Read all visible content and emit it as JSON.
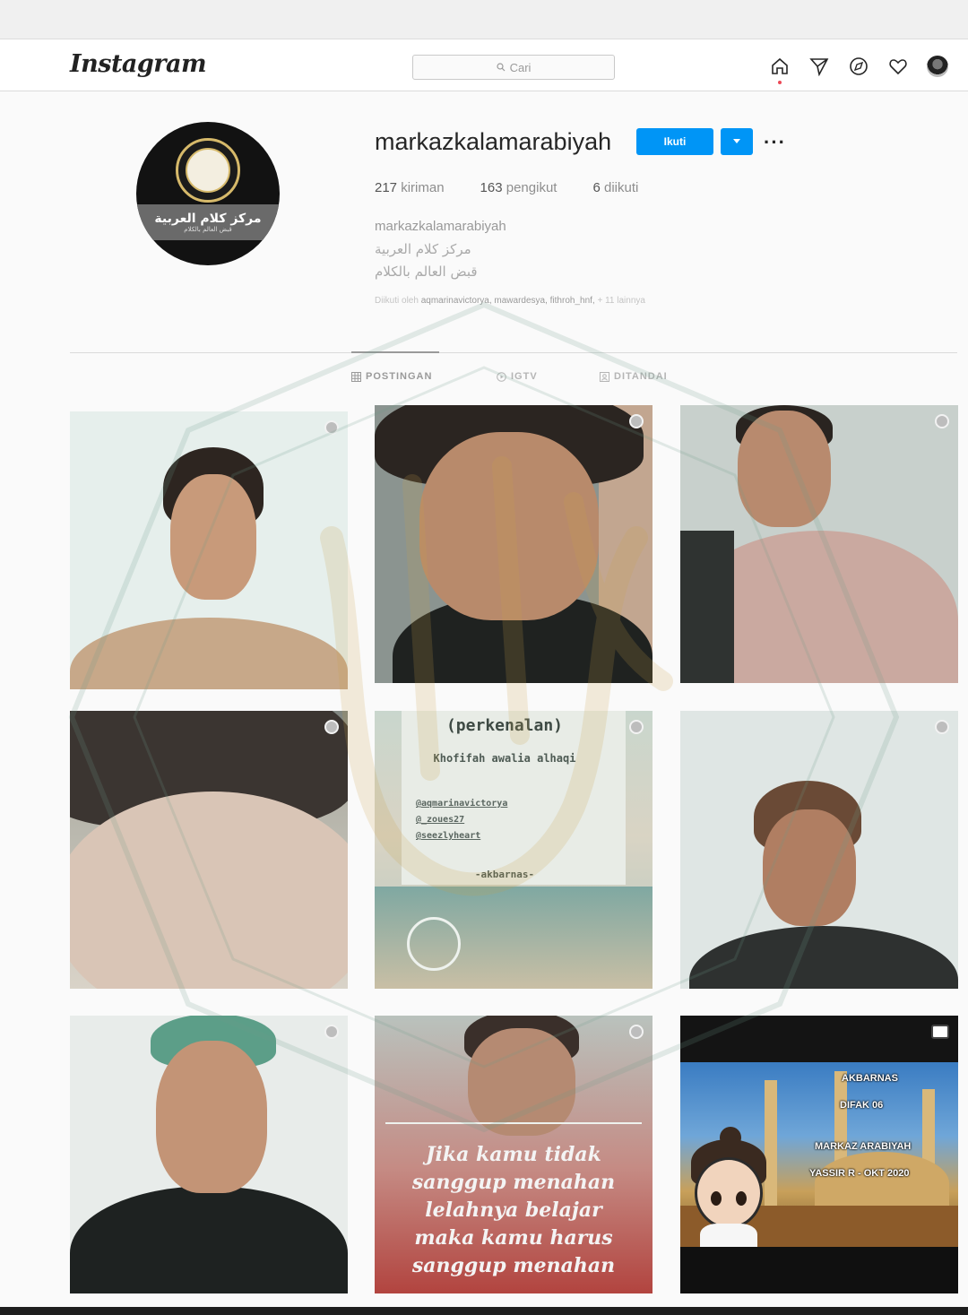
{
  "header": {
    "logo": "Instagram",
    "search_placeholder": "Cari"
  },
  "nav": {
    "icons": [
      "home-icon",
      "direct-icon",
      "explore-icon",
      "activity-heart-icon",
      "profile-avatar"
    ]
  },
  "profile": {
    "avatar_name_ar": "مركز كلام العربية",
    "avatar_tagline_ar": "قبض العالم بالكلام",
    "username": "markazkalamarabiyah",
    "follow_label": "Ikuti",
    "more_label": "···",
    "stats": {
      "posts_count": "217",
      "posts_label": "kiriman",
      "followers_count": "163",
      "followers_label": "pengikut",
      "following_count": "6",
      "following_label": "diikuti"
    },
    "full_name": "markazkalamarabiyah",
    "bio_line1": "مركز كلام العربية",
    "bio_line2": "قبض العالم بالكلام",
    "followed_by_prefix": "Diikuti oleh",
    "followed_by_names": "aqmarinavictorya, mawardesya, fithroh_hnf,",
    "followed_by_suffix": "+ 11 lainnya"
  },
  "tabs": [
    {
      "label": "POSTINGAN",
      "active": true
    },
    {
      "label": "IGTV",
      "active": false
    },
    {
      "label": "DITANDAI",
      "active": false
    }
  ],
  "posts": {
    "p5": {
      "title": "(perkenalan)",
      "subtitle": "Khofifah awalia alhaqi",
      "handle1": "@aqmarinavictorya",
      "handle2": "@_zoues27",
      "handle3": "@seezlyheart",
      "signature": "-akbarnas-"
    },
    "p8": {
      "quote_l1": "Jika kamu tidak",
      "quote_l2": "sanggup menahan",
      "quote_l3": "lelahnya belajar",
      "quote_l4": "maka kamu harus",
      "quote_l5": "sanggup menahan"
    },
    "p9": {
      "cap1": "AKBARNAS",
      "cap2": "DIFAK 06",
      "cap3": "MARKAZ ARABIYAH",
      "cap4": "YASSIR R - OKT 2020"
    }
  },
  "colors": {
    "accent": "#0095f6",
    "background": "#fafafa"
  }
}
